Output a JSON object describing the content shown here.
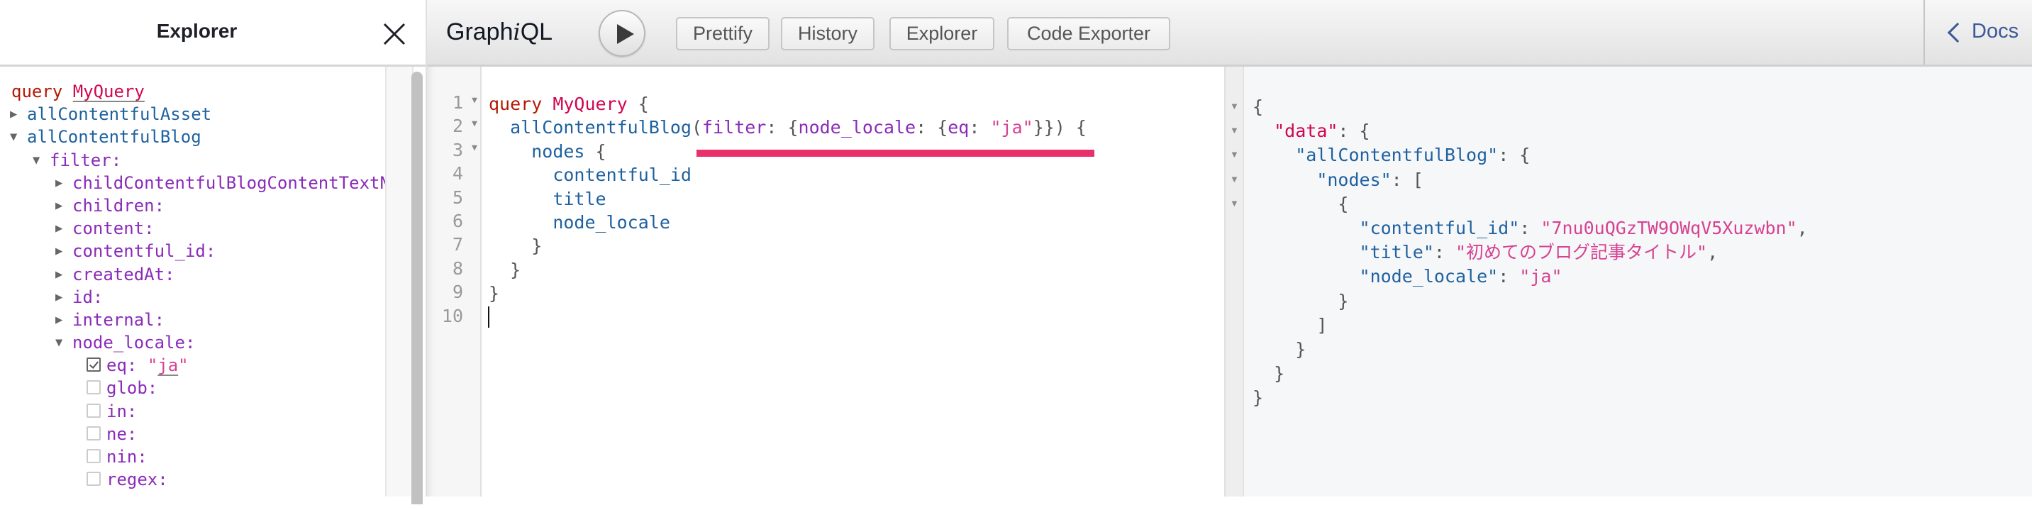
{
  "explorer": {
    "title": "Explorer",
    "close_icon": "close-icon",
    "tree": [
      {
        "type": "op",
        "keyword": "query",
        "name": "MyQuery"
      },
      {
        "type": "field",
        "indent": 0,
        "expanded": false,
        "label": "allContentfulAsset"
      },
      {
        "type": "field",
        "indent": 0,
        "expanded": true,
        "label": "allContentfulBlog"
      },
      {
        "type": "arg",
        "indent": 1,
        "expanded": true,
        "label": "filter:"
      },
      {
        "type": "arg",
        "indent": 2,
        "expanded": false,
        "label": "childContentfulBlogContentTextNode:"
      },
      {
        "type": "arg",
        "indent": 2,
        "expanded": false,
        "label": "children:"
      },
      {
        "type": "arg",
        "indent": 2,
        "expanded": false,
        "label": "content:"
      },
      {
        "type": "arg",
        "indent": 2,
        "expanded": false,
        "label": "contentful_id:"
      },
      {
        "type": "arg",
        "indent": 2,
        "expanded": false,
        "label": "createdAt:"
      },
      {
        "type": "arg",
        "indent": 2,
        "expanded": false,
        "label": "id:"
      },
      {
        "type": "arg",
        "indent": 2,
        "expanded": false,
        "label": "internal:"
      },
      {
        "type": "arg",
        "indent": 2,
        "expanded": true,
        "label": "node_locale:"
      },
      {
        "type": "check",
        "indent": 3,
        "checked": true,
        "label": "eq:",
        "value": "ja"
      },
      {
        "type": "check",
        "indent": 3,
        "checked": false,
        "label": "glob:"
      },
      {
        "type": "check",
        "indent": 3,
        "checked": false,
        "label": "in:"
      },
      {
        "type": "check",
        "indent": 3,
        "checked": false,
        "label": "ne:"
      },
      {
        "type": "check",
        "indent": 3,
        "checked": false,
        "label": "nin:"
      },
      {
        "type": "check",
        "indent": 3,
        "checked": false,
        "label": "regex:"
      }
    ]
  },
  "toolbar": {
    "app_title_prefix": "Graph",
    "app_title_italic": "i",
    "app_title_suffix": "QL",
    "run_icon": "play-icon",
    "buttons": [
      "Prettify",
      "History",
      "Explorer",
      "Code Exporter"
    ],
    "docs_label": "Docs",
    "docs_icon": "chevron-left-icon"
  },
  "editor": {
    "lines": [
      [
        {
          "t": "query",
          "c": "c-kw"
        },
        {
          "t": " "
        },
        {
          "t": "MyQuery",
          "c": "c-def-plain"
        },
        {
          "t": " {",
          "c": "c-punct"
        }
      ],
      [
        {
          "t": "  "
        },
        {
          "t": "allContentfulBlog",
          "c": "c-field"
        },
        {
          "t": "(",
          "c": "c-punct"
        },
        {
          "t": "filter",
          "c": "c-arg"
        },
        {
          "t": ": {",
          "c": "c-punct"
        },
        {
          "t": "node_locale",
          "c": "c-arg"
        },
        {
          "t": ": {",
          "c": "c-punct"
        },
        {
          "t": "eq",
          "c": "c-arg"
        },
        {
          "t": ": ",
          "c": "c-punct"
        },
        {
          "t": "\"ja\"",
          "c": "c-str"
        },
        {
          "t": "}}) {",
          "c": "c-punct"
        }
      ],
      [
        {
          "t": "    "
        },
        {
          "t": "nodes",
          "c": "c-field"
        },
        {
          "t": " {",
          "c": "c-punct"
        }
      ],
      [
        {
          "t": "      "
        },
        {
          "t": "contentful_id",
          "c": "c-field"
        }
      ],
      [
        {
          "t": "      "
        },
        {
          "t": "title",
          "c": "c-field"
        }
      ],
      [
        {
          "t": "      "
        },
        {
          "t": "node_locale",
          "c": "c-field"
        }
      ],
      [
        {
          "t": "    "
        },
        {
          "t": "}",
          "c": "c-punct"
        }
      ],
      [
        {
          "t": "  "
        },
        {
          "t": "}",
          "c": "c-punct"
        }
      ],
      [
        {
          "t": "}",
          "c": "c-punct"
        }
      ],
      []
    ],
    "foldable_lines": [
      1,
      2,
      3
    ]
  },
  "results": {
    "lines": [
      [
        {
          "t": "{",
          "c": "r-punct"
        }
      ],
      [
        {
          "t": "  "
        },
        {
          "t": "\"data\"",
          "c": "r-key-top"
        },
        {
          "t": ": {",
          "c": "r-punct"
        }
      ],
      [
        {
          "t": "    "
        },
        {
          "t": "\"allContentfulBlog\"",
          "c": "r-key"
        },
        {
          "t": ": {",
          "c": "r-punct"
        }
      ],
      [
        {
          "t": "      "
        },
        {
          "t": "\"nodes\"",
          "c": "r-key"
        },
        {
          "t": ": [",
          "c": "r-punct"
        }
      ],
      [
        {
          "t": "        "
        },
        {
          "t": "{",
          "c": "r-punct"
        }
      ],
      [
        {
          "t": "          "
        },
        {
          "t": "\"contentful_id\"",
          "c": "r-key"
        },
        {
          "t": ": ",
          "c": "r-punct"
        },
        {
          "t": "\"7nu0uQGzTW9OWqV5Xuzwbn\"",
          "c": "r-str"
        },
        {
          "t": ",",
          "c": "r-punct"
        }
      ],
      [
        {
          "t": "          "
        },
        {
          "t": "\"title\"",
          "c": "r-key"
        },
        {
          "t": ": ",
          "c": "r-punct"
        },
        {
          "t": "\"初めてのブログ記事タイトル\"",
          "c": "r-str"
        },
        {
          "t": ",",
          "c": "r-punct"
        }
      ],
      [
        {
          "t": "          "
        },
        {
          "t": "\"node_locale\"",
          "c": "r-key"
        },
        {
          "t": ": ",
          "c": "r-punct"
        },
        {
          "t": "\"ja\"",
          "c": "r-str"
        }
      ],
      [
        {
          "t": "        "
        },
        {
          "t": "}",
          "c": "r-punct"
        }
      ],
      [
        {
          "t": "      "
        },
        {
          "t": "]",
          "c": "r-punct"
        }
      ],
      [
        {
          "t": "    "
        },
        {
          "t": "}",
          "c": "r-punct"
        }
      ],
      [
        {
          "t": "  "
        },
        {
          "t": "}",
          "c": "r-punct"
        }
      ],
      [
        {
          "t": "}",
          "c": "r-punct"
        }
      ]
    ],
    "foldable_lines": [
      1,
      2,
      3,
      4,
      5
    ]
  },
  "colors": {
    "highlight_bar": "#e8306b",
    "keyword": "#b11a04",
    "definition": "#d2054e",
    "field": "#1f61a0",
    "argument": "#8b2bb9",
    "string": "#d64292",
    "docs_link": "#3b5998"
  }
}
